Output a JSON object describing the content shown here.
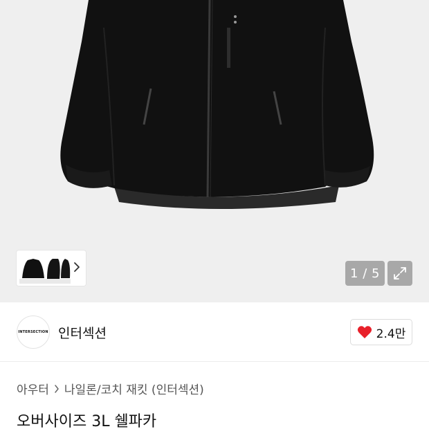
{
  "gallery": {
    "counter": "1 / 5",
    "main_image_icon": "black-jacket-photo",
    "thumbnail_icon": "jacket-thumbnails",
    "next_icon": "chevron-right-icon",
    "expand_icon": "expand-arrows-icon"
  },
  "brand": {
    "logo_text": "INTERSECTION",
    "name": "인터섹션",
    "like_icon": "heart-icon",
    "like_count": "2.4만",
    "like_color": "#e8202a"
  },
  "breadcrumb": {
    "category": "아우터",
    "subcategory": "나일론/코치 재킷 (인터섹션)"
  },
  "product": {
    "title": "오버사이즈 3L 쉘파카"
  }
}
